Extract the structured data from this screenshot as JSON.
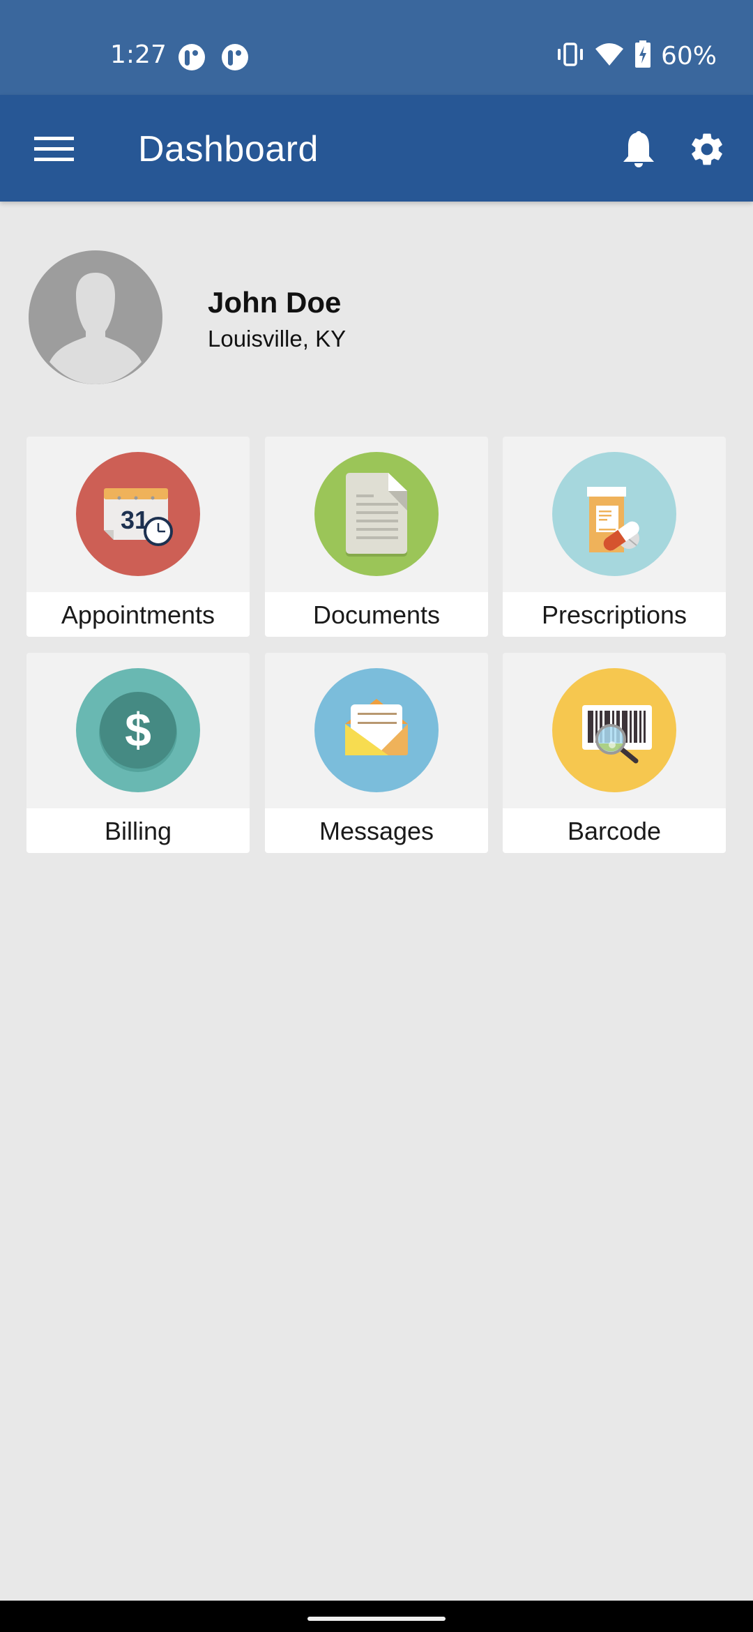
{
  "status_bar": {
    "time": "1:27",
    "notification_icons": [
      "app-notification-icon",
      "app-notification-icon"
    ],
    "system_icons": [
      "vibrate-icon",
      "wifi-icon",
      "battery-charging-icon"
    ],
    "battery_percent": "60%"
  },
  "app_bar": {
    "title": "Dashboard",
    "left_icon": "menu-icon",
    "right_icons": [
      "bell-icon",
      "gear-icon"
    ]
  },
  "profile": {
    "name": "John Doe",
    "location": "Louisville, KY",
    "avatar_icon": "default-avatar-icon"
  },
  "tiles": [
    {
      "label": "Appointments",
      "icon": "calendar-clock-icon",
      "color": "#cd5f55",
      "calendar_day": "31"
    },
    {
      "label": "Documents",
      "icon": "document-icon",
      "color": "#9bc558"
    },
    {
      "label": "Prescriptions",
      "icon": "pill-bottle-icon",
      "color": "#a6d7dd"
    },
    {
      "label": "Billing",
      "icon": "dollar-icon",
      "color": "#69b8b2",
      "symbol": "$"
    },
    {
      "label": "Messages",
      "icon": "envelope-icon",
      "color": "#7bbddb"
    },
    {
      "label": "Barcode",
      "icon": "barcode-scan-icon",
      "color": "#f6c74f"
    }
  ],
  "colors": {
    "status_bar": "#3a679d",
    "app_bar": "#275795",
    "background": "#e8e8e8"
  }
}
